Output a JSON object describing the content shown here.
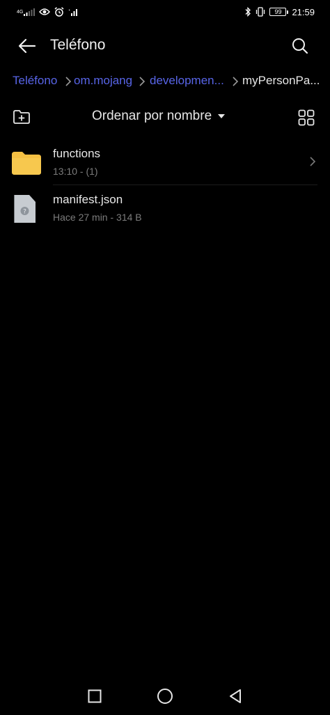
{
  "status_bar": {
    "network_label": "4G",
    "battery_level": "99",
    "time": "21:59",
    "icons": [
      "signal-icon",
      "eye-icon",
      "alarm-icon",
      "wifi-signal-icon",
      "bluetooth-icon",
      "vibrate-icon",
      "battery-icon"
    ]
  },
  "app_bar": {
    "title": "Teléfono",
    "back_icon": "arrow-left-icon",
    "search_icon": "search-icon"
  },
  "breadcrumb": {
    "items": [
      {
        "label": "Teléfono"
      },
      {
        "label": "om.mojang"
      },
      {
        "label": "developmen..."
      },
      {
        "label": "myPersonPa..."
      }
    ]
  },
  "toolbar": {
    "sort_label": "Ordenar por nombre",
    "new_folder_icon": "new-folder-icon",
    "view_icon": "grid-view-icon"
  },
  "files": [
    {
      "name": "functions",
      "meta": "13:10 - (1)",
      "type": "folder"
    },
    {
      "name": "manifest.json",
      "meta": "Hace 27 min - 314 B",
      "type": "file"
    }
  ],
  "colors": {
    "background": "#000000",
    "accent": "#5865e8",
    "folder": "#f5c043",
    "text_primary": "#e8e8e8",
    "text_secondary": "#7c7c7c"
  },
  "nav_bar": {
    "icons": [
      "recents-square-icon",
      "home-circle-icon",
      "back-triangle-icon"
    ]
  }
}
